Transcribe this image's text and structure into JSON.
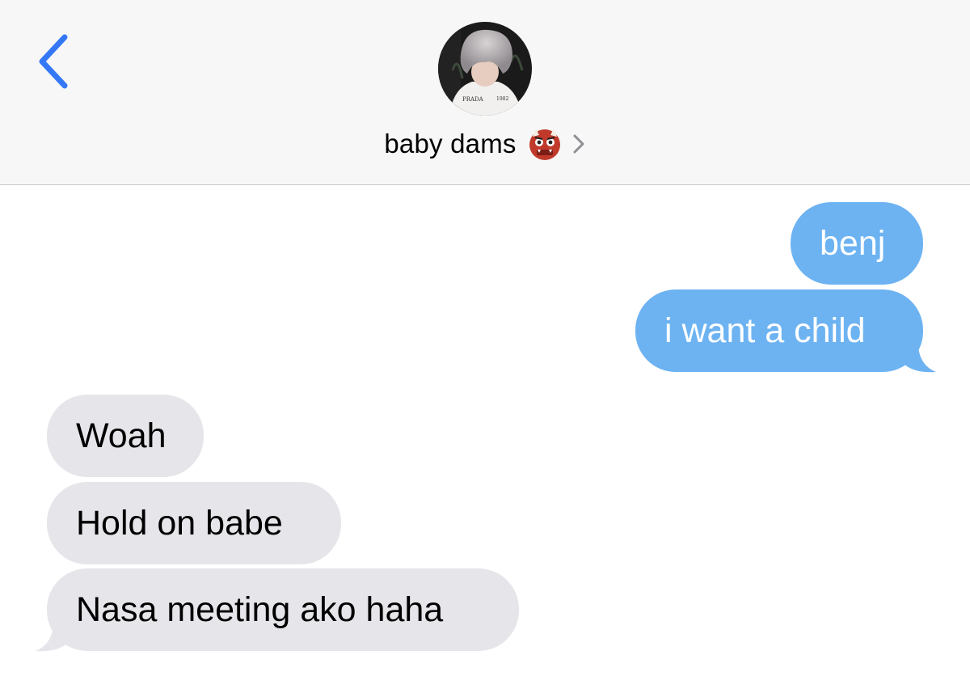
{
  "header": {
    "contact_name": "baby dams",
    "contact_emoji_icon": "japanese-ogre-icon",
    "back_icon": "chevron-left-icon",
    "disclosure_icon": "chevron-right-icon",
    "accent_color": "#3478f6",
    "background_color": "#f7f7f7"
  },
  "messages": [
    {
      "direction": "sent",
      "text": "benj"
    },
    {
      "direction": "sent",
      "text": "i want a child"
    },
    {
      "direction": "received",
      "text": "Woah"
    },
    {
      "direction": "received",
      "text": "Hold on babe"
    },
    {
      "direction": "received",
      "text": "Nasa meeting ako haha"
    }
  ],
  "colors": {
    "sent_bubble": "#6db3f2",
    "received_bubble": "#e5e5ea"
  }
}
